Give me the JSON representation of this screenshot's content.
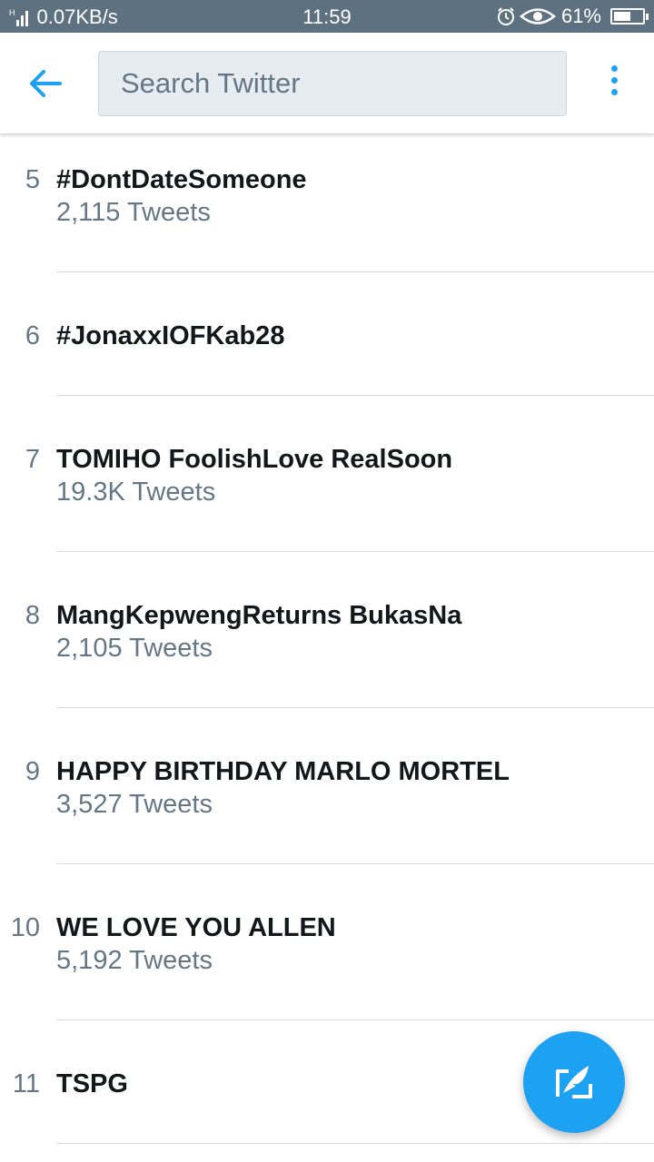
{
  "status_bar": {
    "network_speed": "0.07KB/s",
    "time": "11:59",
    "battery": "61%",
    "battery_level": 0.61,
    "network_type": "H"
  },
  "header": {
    "search_placeholder": "Search Twitter"
  },
  "trends": [
    {
      "rank": "5",
      "name": "#DontDateSomeone",
      "count": "2,115 Tweets"
    },
    {
      "rank": "6",
      "name": "#JonaxxIOFKab28",
      "count": ""
    },
    {
      "rank": "7",
      "name": "TOMIHO FoolishLove RealSoon",
      "count": "19.3K Tweets"
    },
    {
      "rank": "8",
      "name": "MangKepwengReturns BukasNa",
      "count": "2,105 Tweets"
    },
    {
      "rank": "9",
      "name": "HAPPY BIRTHDAY MARLO MORTEL",
      "count": "3,527 Tweets"
    },
    {
      "rank": "10",
      "name": "WE LOVE YOU ALLEN",
      "count": "5,192 Tweets"
    },
    {
      "rank": "11",
      "name": "TSPG",
      "count": ""
    }
  ],
  "colors": {
    "accent": "#1da1f2",
    "status_bar": "#5d7180",
    "text_primary": "#14171a",
    "text_secondary": "#657786"
  },
  "icons": {
    "back": "back-arrow-icon",
    "more": "more-vertical-icon",
    "compose": "compose-tweet-icon"
  }
}
